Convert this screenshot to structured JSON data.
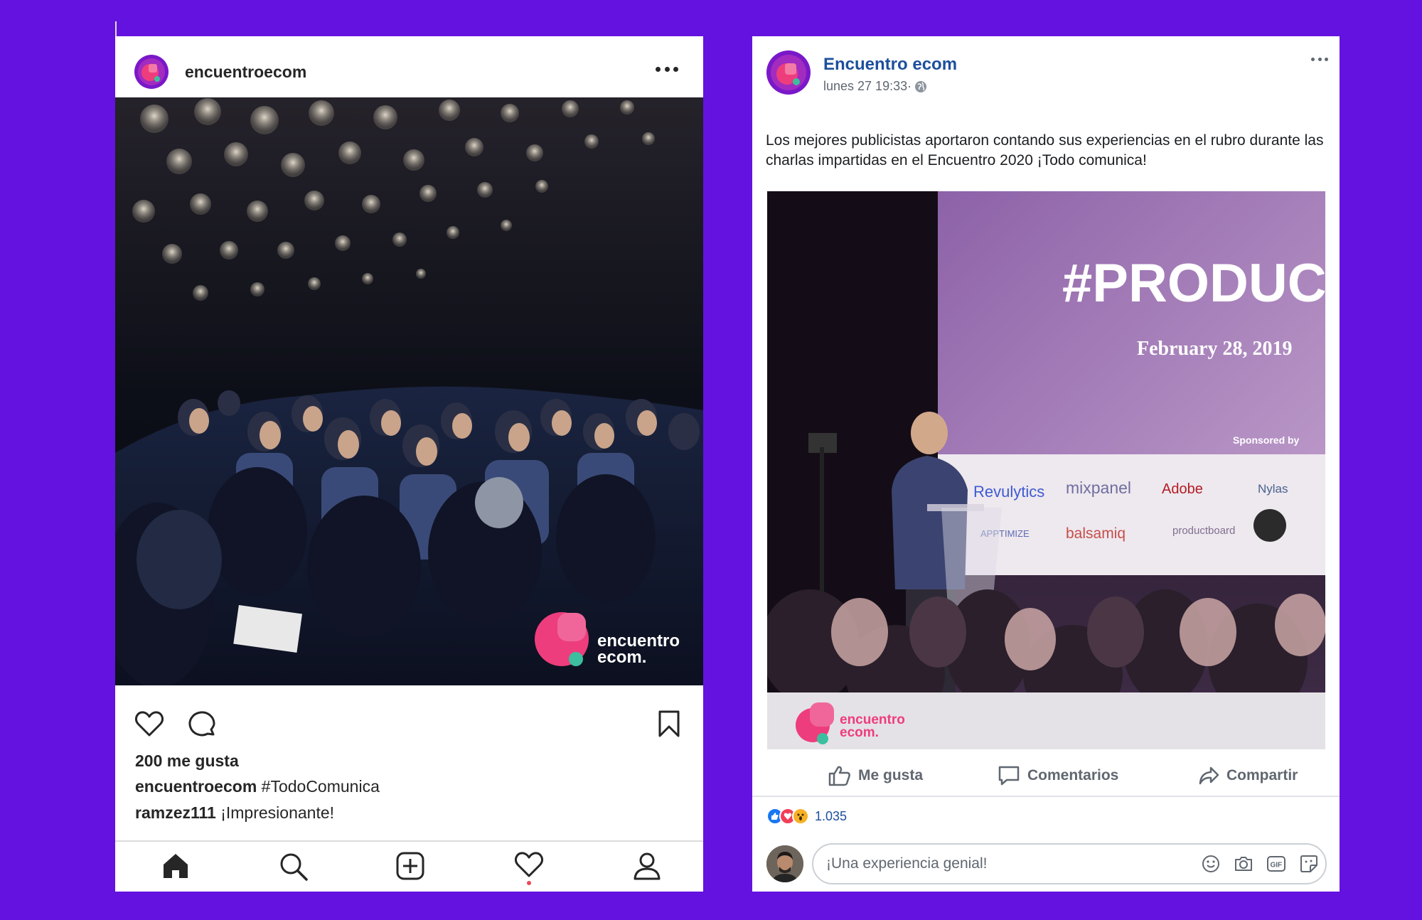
{
  "instagram": {
    "username": "encuentroecom",
    "likes": "200 me gusta",
    "caption_user": "encuentroecom",
    "caption_text": " #TodoComunica",
    "comment_user": "ramzez111",
    "comment_text": " ¡Impresionante!",
    "watermark_line1": "encuentro",
    "watermark_line2": "ecom.",
    "icons": {
      "like": "heart-icon",
      "comment": "comment-icon",
      "save": "bookmark-icon",
      "nav": [
        "home-icon",
        "search-icon",
        "add-post-icon",
        "activity-heart-icon",
        "profile-icon"
      ]
    }
  },
  "facebook": {
    "page_name": "Encuentro ecom",
    "post_date": "lunes 27  19:33·",
    "post_text": "Los mejores publicistas aportaron contando sus experiencias en el rubro durante las charlas impartidas en el Encuentro 2020 ¡Todo comunica!",
    "screen": {
      "hashtag": "#PRODUC",
      "date": "February 28, 2019",
      "sponsored_by": "Sponsored by",
      "sponsors": [
        "Revulytics",
        "mixpanel",
        "Adobe",
        "Nylas",
        "APPTIMIZE",
        "balsamiq",
        "productboard"
      ]
    },
    "banner_line1": "encuentro",
    "banner_line2": "ecom.",
    "actions": {
      "like": "Me gusta",
      "comment": "Comentarios",
      "share": "Compartir"
    },
    "reaction_count": "1.035",
    "comment_placeholder": "¡Una experiencia genial!",
    "icons": {
      "like": "thumbs-up-icon",
      "comment": "speech-bubble-icon",
      "share": "share-arrow-icon",
      "input": [
        "emoji-icon",
        "camera-icon",
        "gif-icon",
        "sticker-icon"
      ]
    }
  },
  "colors": {
    "background": "#6412df",
    "brand_pink": "#ee3d7c",
    "brand_teal": "#3cbf9f",
    "facebook_blue": "#1d4f9c"
  }
}
